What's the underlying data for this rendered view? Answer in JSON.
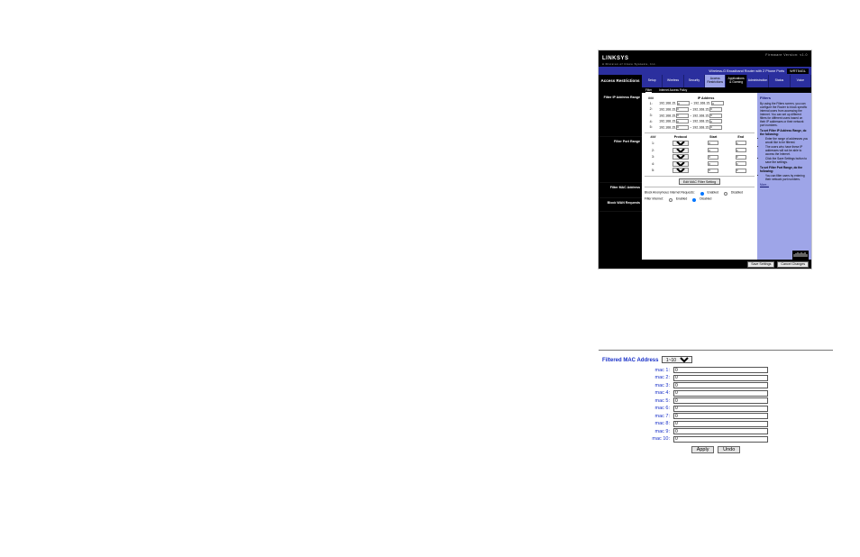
{
  "router": {
    "brand": "LINKSYS",
    "brand_sub": "A Division of Cisco Systems, Inc.",
    "fw": "Firmware Version: v1.0",
    "product": "Wireless-G Broadband Router with 2 Phone Ports",
    "model": "WRT54GL",
    "page_title": "Access Restrictions",
    "tabs": [
      "Setup",
      "Wireless",
      "Security",
      "Access Restrictions",
      "Applications & Gaming",
      "Administration",
      "Status",
      "Voice"
    ],
    "subtabs": {
      "a": "Filter",
      "b": "Internet Access Policy"
    },
    "left": {
      "ipr": "Filter IP Address Range",
      "pr": "Filter Port Range",
      "mac": "Filter MAC Address",
      "wan": "Block WAN Requests"
    },
    "ip_table": {
      "col_num": "###",
      "col_ip": "IP Address",
      "prefix": "192.168.15.",
      "rows": [
        "1:",
        "2:",
        "3:",
        "4:",
        "5:"
      ],
      "val": "0"
    },
    "port_table": {
      "col_num": "###",
      "col_proto": "Protocol",
      "col_start": "Start",
      "col_end": "End",
      "rows": [
        "1:",
        "2:",
        "3:",
        "4:",
        "5:"
      ],
      "proto": "TCP",
      "val": "0"
    },
    "mac_btn": "Edit MAC Filter Setting",
    "block": {
      "line": "Block Anonymous Internet Requests:",
      "en": "Enabled",
      "dis": "Disabled",
      "redir": "Filter Internet:",
      "r_en": "Enabled",
      "r_dis": "Disabled"
    },
    "help": {
      "title": "Filters",
      "p1": "By using the Filters screen, you can configure the Router to block specific internal users from accessing the Internet. You can set up different filters for different users based on their IP addresses or their network port numbers.",
      "s1": "To set Filter IP Address Range, do the following:",
      "s1_li": [
        "Enter the range of addresses you would like to be filtered.",
        "The users who have these IP addresses will not be able to access the Internet.",
        "Click the Save Settings button to save the settings."
      ],
      "s2": "To set Filter Port Range, do the following:",
      "s2_li": [
        "You can filter users by entering their network port numbers."
      ],
      "more": "More..."
    },
    "save": "Save Settings",
    "cancel": "Cancel Changes"
  },
  "mac": {
    "title": "Filtered MAC Address",
    "range": "1~10",
    "labels": [
      "mac 1:",
      "mac 2:",
      "mac 3:",
      "mac 4:",
      "mac 5:",
      "mac 6:",
      "mac 7:",
      "mac 8:",
      "mac 9:",
      "mac 10:"
    ],
    "val": "0",
    "apply": "Apply",
    "undo": "Undo"
  }
}
